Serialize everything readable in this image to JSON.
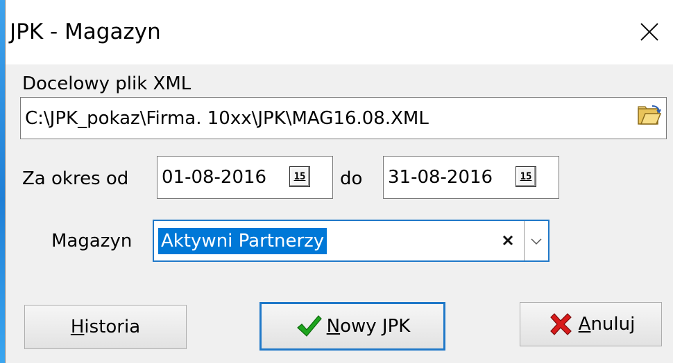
{
  "window": {
    "title": "JPK - Magazyn"
  },
  "file": {
    "label": "Docelowy plik XML",
    "value": "C:\\JPK_pokaz\\Firma. 10xx\\JPK\\MAG16.08.XML"
  },
  "period": {
    "from_label": "Za okres od",
    "from_value": "01-08-2016",
    "to_label": "do",
    "to_value": "31-08-2016",
    "calendar_day": "15"
  },
  "warehouse": {
    "label": "Magazyn",
    "value": "Aktywni Partnerzy",
    "clear_glyph": "×"
  },
  "buttons": {
    "history": {
      "accel": "H",
      "rest": "istoria"
    },
    "new": {
      "accel": "N",
      "rest": "owy JPK"
    },
    "cancel": {
      "accel": "A",
      "rest": "nuluj"
    }
  },
  "colors": {
    "accent": "#1f78c8",
    "selection": "#0078d7",
    "check": "#1ea51e",
    "cross": "#d81b1b"
  }
}
